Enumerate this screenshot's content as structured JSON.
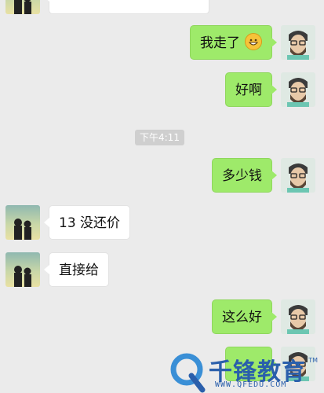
{
  "messages": [
    {
      "side": "them",
      "text": ""
    },
    {
      "side": "me",
      "text": "我走了",
      "emoji": "grinning-face-emoji"
    },
    {
      "side": "me",
      "text": "好啊"
    },
    {
      "side": "me",
      "text": "多少钱"
    },
    {
      "side": "them",
      "text": "13 没还价"
    },
    {
      "side": "them",
      "text": "直接给"
    },
    {
      "side": "me",
      "text": "这么好"
    },
    {
      "side": "me",
      "text": ""
    }
  ],
  "timestamp": "下午4:11",
  "watermark": {
    "brand": "千锋教育",
    "url": "WWW.QFEDU.COM",
    "trademark": "TM"
  },
  "colors": {
    "background": "#ebebeb",
    "my_bubble": "#9eea6a",
    "their_bubble": "#ffffff",
    "watermark": "#2a5fab"
  }
}
